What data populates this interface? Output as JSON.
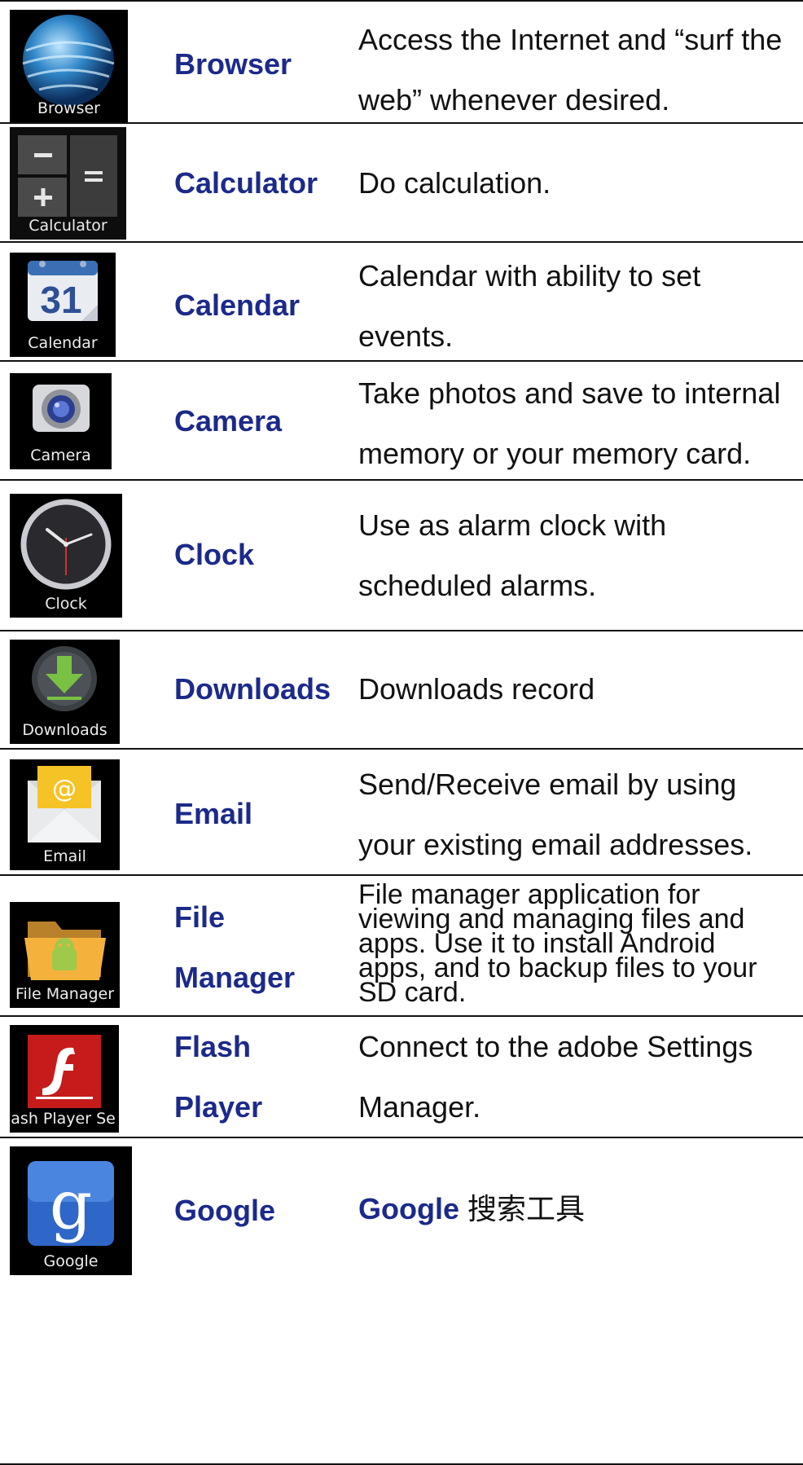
{
  "rows": [
    {
      "icon": "globe-icon",
      "icon_label": "Browser",
      "name_lines": [
        "Browser"
      ],
      "desc_lines": [
        "Access the Internet and “surf the",
        "web” whenever desired."
      ]
    },
    {
      "icon": "calculator-icon",
      "icon_label": "Calculator",
      "name_lines": [
        "Calculator"
      ],
      "desc_lines": [
        "Do calculation."
      ]
    },
    {
      "icon": "calendar-icon",
      "icon_label": "Calendar",
      "icon_number": "31",
      "name_lines": [
        "Calendar"
      ],
      "desc_lines": [
        "Calendar with ability to set",
        "events."
      ]
    },
    {
      "icon": "camera-icon",
      "icon_label": "Camera",
      "name_lines": [
        "Camera"
      ],
      "desc_lines": [
        "Take photos and save to internal",
        "memory or your memory card."
      ]
    },
    {
      "icon": "clock-icon",
      "icon_label": "Clock",
      "name_lines": [
        "Clock"
      ],
      "desc_lines": [
        "Use as alarm clock with",
        "scheduled alarms."
      ]
    },
    {
      "icon": "download-icon",
      "icon_label": "Downloads",
      "name_lines": [
        "Downloads"
      ],
      "desc_lines": [
        "Downloads record"
      ]
    },
    {
      "icon": "envelope-icon",
      "icon_label": "Email",
      "name_lines": [
        "Email"
      ],
      "desc_lines": [
        "Send/Receive email by using",
        "your existing email addresses."
      ]
    },
    {
      "icon": "folder-icon",
      "icon_label": "File Manager",
      "name_lines": [
        "File",
        "Manager"
      ],
      "desc_lines": [
        "File manager application for",
        "viewing and managing files and",
        "apps. Use it to install Android",
        "apps, and to backup files to your",
        "SD card."
      ]
    },
    {
      "icon": "flash-icon",
      "icon_label": "lash Player Se",
      "name_lines": [
        "Flash",
        "Player"
      ],
      "desc_lines": [
        "Connect to the adobe Settings",
        "Manager."
      ]
    },
    {
      "icon": "google-icon",
      "icon_label": "Google",
      "icon_letter": "g",
      "name_lines": [
        "Google"
      ],
      "desc_lines": [
        "Google",
        "搜索工具"
      ]
    }
  ],
  "colors": {
    "app_name": "#1b2a8a",
    "rule": "#111111",
    "icon_bg": "#000000"
  }
}
